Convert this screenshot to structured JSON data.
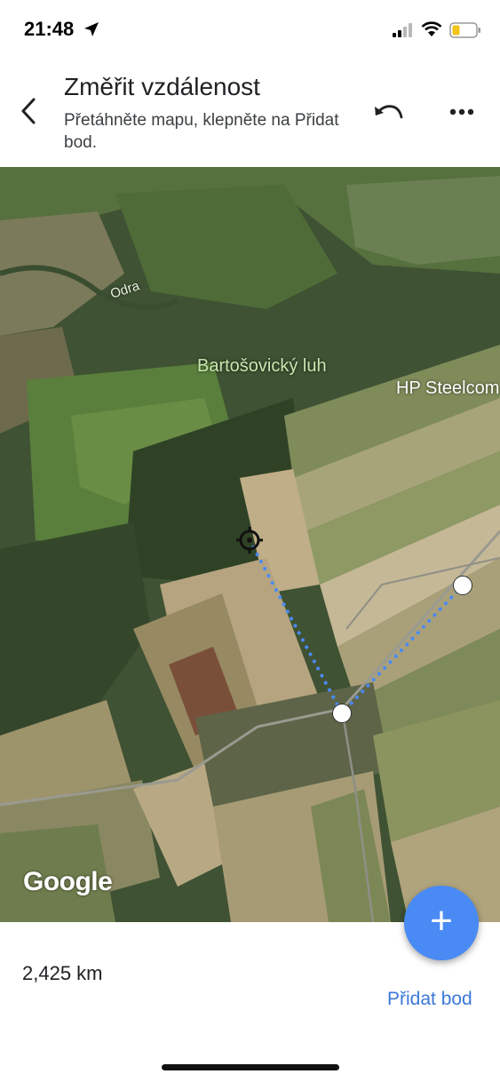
{
  "status_bar": {
    "time": "21:48"
  },
  "header": {
    "title": "Změřit vzdálenost",
    "subtitle": "Přetáhněte mapu, klepněte na Přidat bod."
  },
  "map": {
    "labels": {
      "river": "Odra",
      "area": "Bartošovický luh",
      "poi": "HP Steelcom"
    },
    "attribution": "Google"
  },
  "bottom": {
    "distance": "2,425 km",
    "add_point_label": "Přidat bod",
    "fab_symbol": "+"
  },
  "colors": {
    "measure_line": "#4a8af4",
    "link": "#3b78d8",
    "fab": "#4a8af4"
  }
}
